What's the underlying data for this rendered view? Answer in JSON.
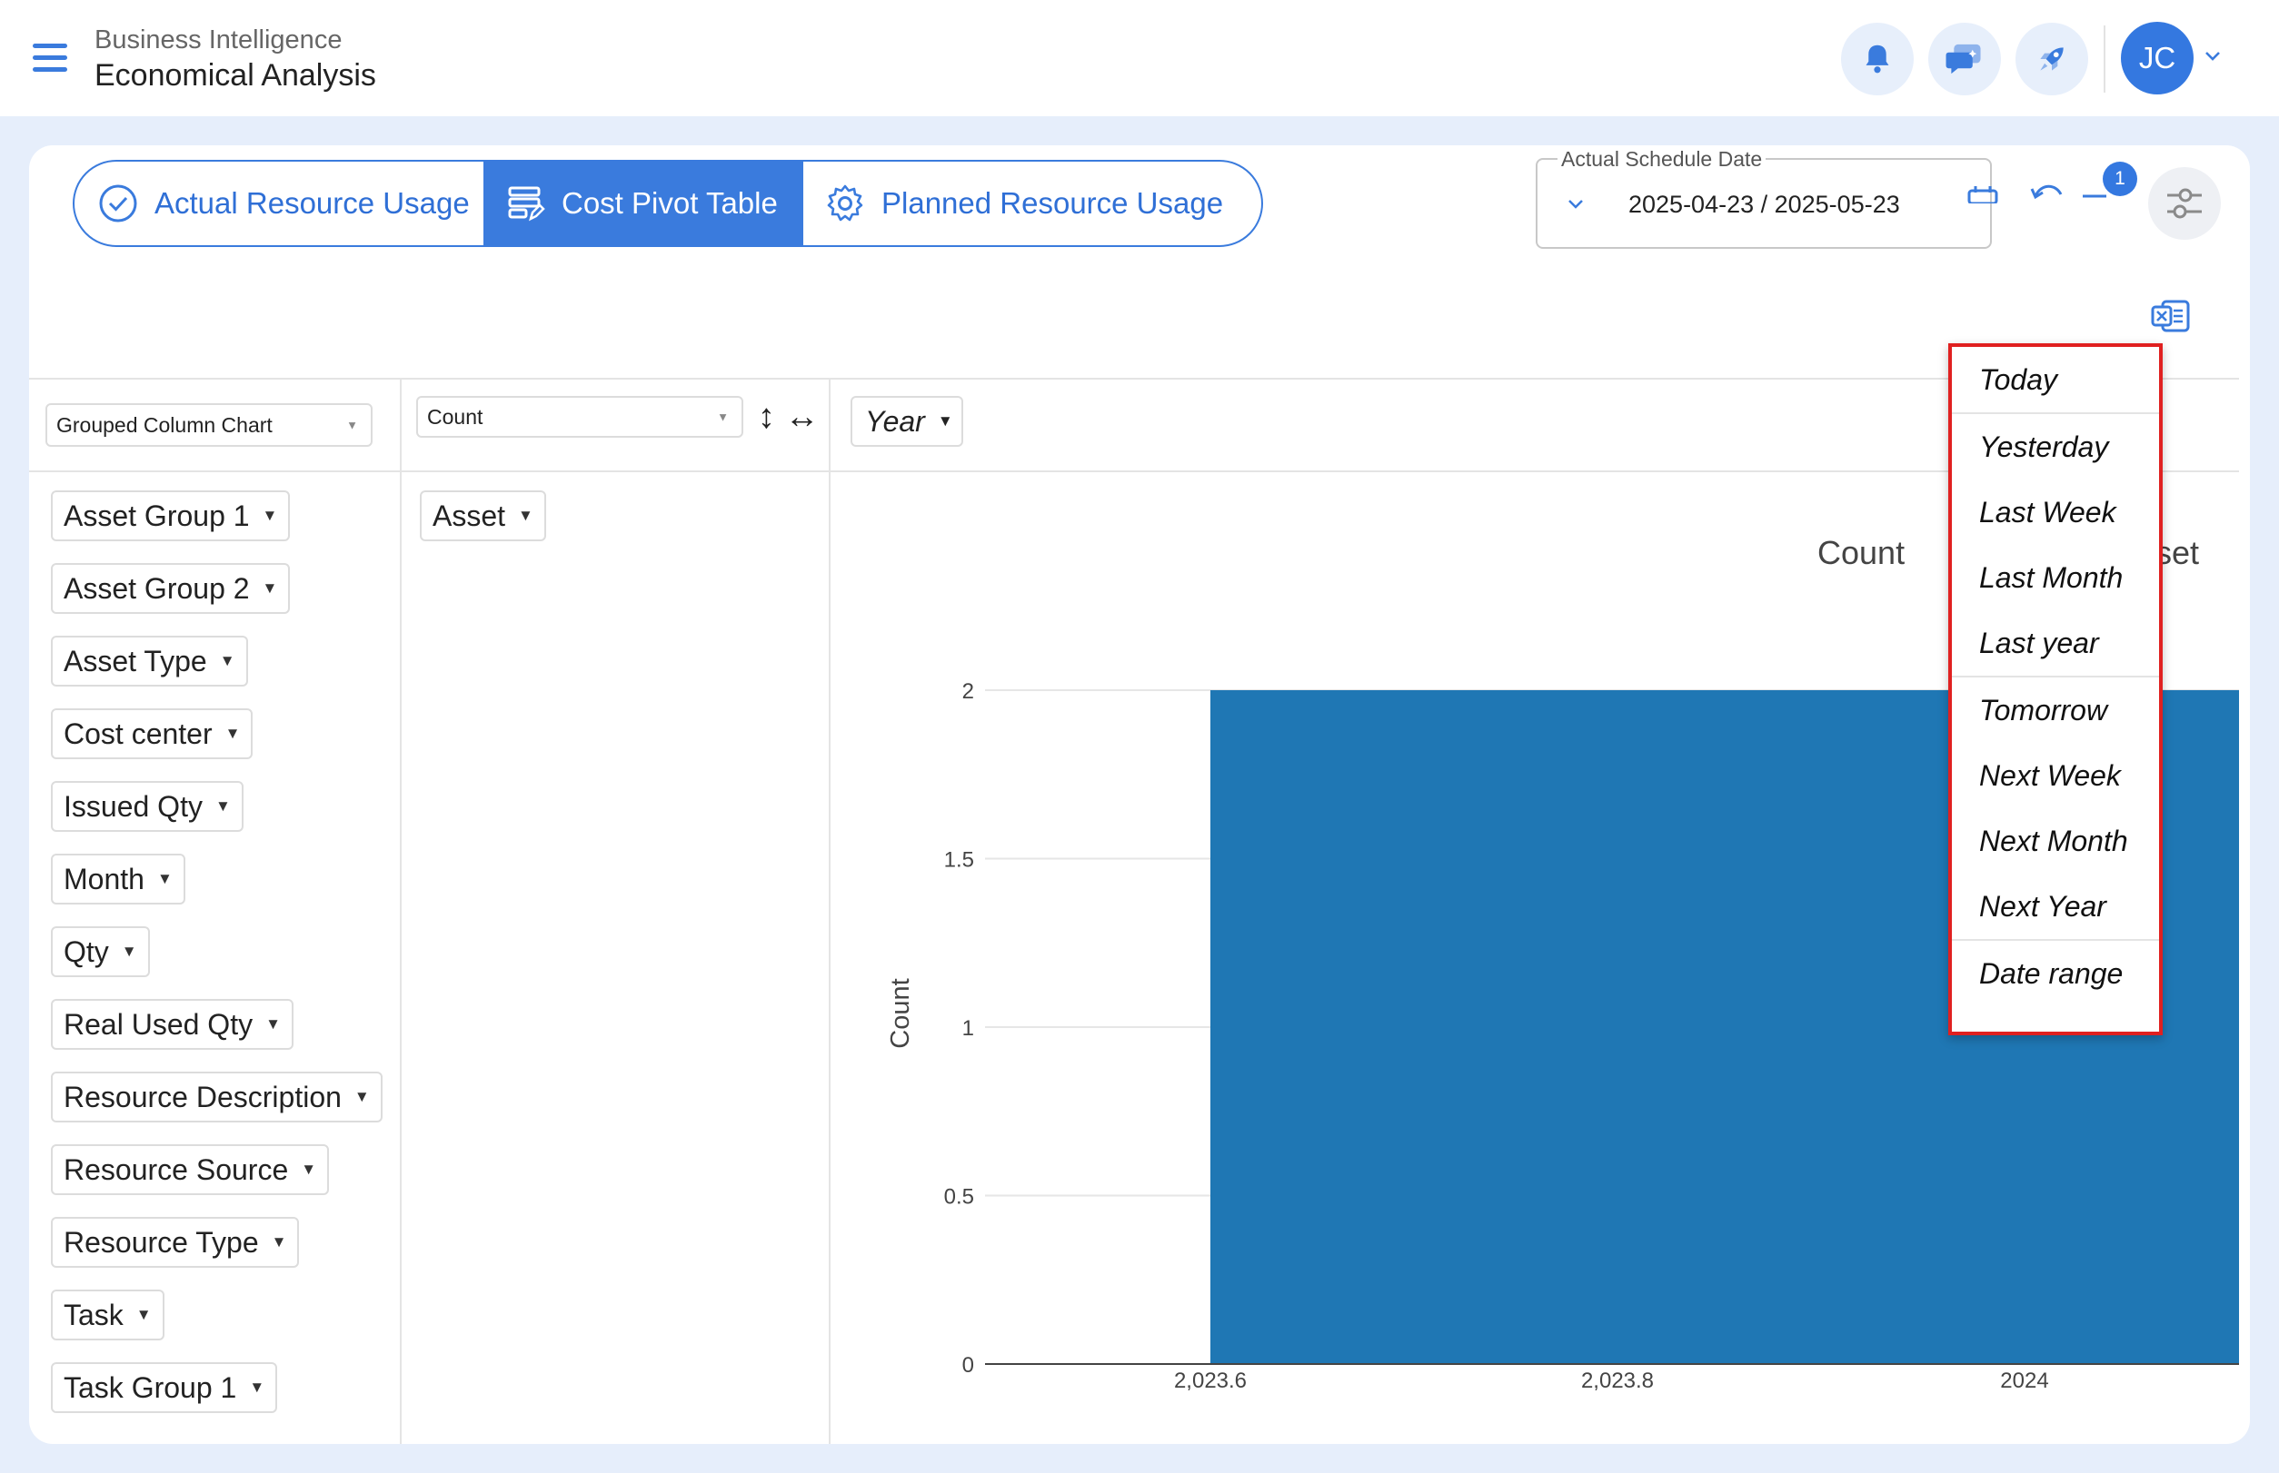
{
  "header": {
    "subtitle": "Business Intelligence",
    "title": "Economical Analysis",
    "avatar_initials": "JC"
  },
  "tabs": [
    {
      "label": "Actual Resource Usage",
      "active": false
    },
    {
      "label": "Cost Pivot Table",
      "active": true
    },
    {
      "label": "Planned Resource Usage",
      "active": false
    }
  ],
  "date_filter": {
    "label": "Actual Schedule Date",
    "value": "2025-04-23 / 2025-05-23",
    "badge_count": "1"
  },
  "pivot": {
    "renderer": "Grouped Column Chart",
    "aggregator": "Count",
    "column_attr": "Year",
    "row_attr": "Asset",
    "unused_attrs": [
      "Asset Group 1",
      "Asset Group 2",
      "Asset Type",
      "Cost center",
      "Issued Qty",
      "Month",
      "Qty",
      "Real Used Qty",
      "Resource Description",
      "Resource Source",
      "Resource Type",
      "Task",
      "Task Group 1"
    ]
  },
  "chart_data": {
    "type": "bar",
    "title_left": "Count",
    "title_right": "set",
    "ylabel": "Count",
    "xlabel": "",
    "ylim": [
      0,
      2
    ],
    "y_ticks": [
      "0",
      "0.5",
      "1",
      "1.5",
      "2"
    ],
    "x_ticks": [
      "2,023.6",
      "2,023.8",
      "2024"
    ],
    "bar": {
      "x_start": 2023.6,
      "x_end_visible": 2024.2,
      "value": 2
    },
    "bar_color": "#1f77b4"
  },
  "date_menu": {
    "groups": [
      [
        "Today"
      ],
      [
        "Yesterday",
        "Last Week",
        "Last Month",
        "Last year"
      ],
      [
        "Tomorrow",
        "Next Week",
        "Next Month",
        "Next Year"
      ],
      [
        "Date range"
      ]
    ]
  },
  "colors": {
    "accent": "#3a7bdd",
    "avatar": "#3478e0",
    "highlight_border": "#e02020",
    "page_bg": "#e6eefb"
  }
}
